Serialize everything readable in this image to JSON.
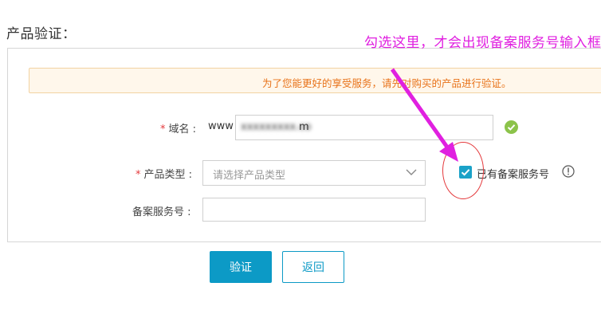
{
  "page": {
    "title": "产品验证："
  },
  "notice": {
    "text": "为了您能更好的享受服务，请先对购买的产品进行验证。"
  },
  "form": {
    "domain": {
      "required_mark": "*",
      "label": "域名 :",
      "prefix": "www",
      "value_masked": "xxxxxxxxx.co",
      "value_tail": "m",
      "status_icon": "check-circle-icon"
    },
    "product_type": {
      "required_mark": "*",
      "label": "产品类型 :",
      "placeholder": "请选择产品类型",
      "icon": "chevron-down-icon"
    },
    "beian_checkbox": {
      "checked": true,
      "label": "已有备案服务号",
      "info_icon": "info-icon"
    },
    "beian_number": {
      "label": "备案服务号 :",
      "value": ""
    }
  },
  "buttons": {
    "verify": "验证",
    "back": "返回"
  },
  "annotation": {
    "text": "勾选这里，才会出现备案服务号输入框",
    "color": "#e020e0"
  },
  "colors": {
    "primary": "#0c9ac6",
    "notice_text": "#e8731a",
    "success": "#8cc34a",
    "required": "#e4393c"
  }
}
